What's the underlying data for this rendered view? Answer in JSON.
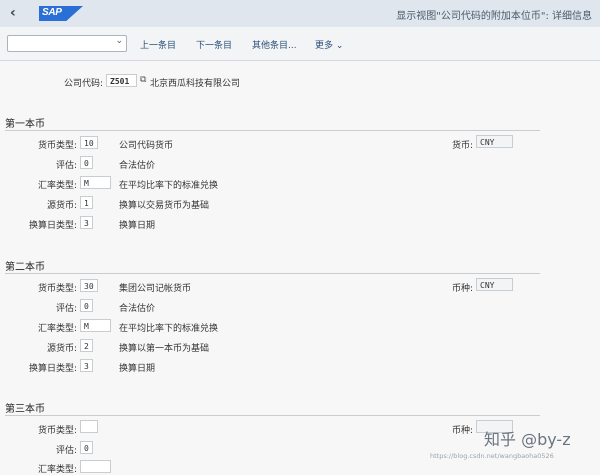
{
  "title": {
    "back": "‹",
    "logo": "SAP",
    "window_title": "显示视图\"公司代码的附加本位币\": 详细信息"
  },
  "toolbar": {
    "select_value": "",
    "prev": "上一条目",
    "next": "下一条目",
    "other": "其他条目...",
    "more": "更多"
  },
  "company": {
    "label": "公司代码:",
    "code": "Z501",
    "name": "北京西瓜科技有限公司"
  },
  "sec1": {
    "title": "第一本币",
    "type_label": "货币类型:",
    "type": "10",
    "type_text": "公司代码货币",
    "curr_label": "货币:",
    "curr": "CNY",
    "val_label": "评估:",
    "val": "0",
    "val_text": "合法估价",
    "rate_label": "汇率类型:",
    "rate": "M",
    "rate_text": "在平均比率下的标准兑换",
    "src_label": "源货币:",
    "src": "1",
    "src_text": "换算以交易货币为基础",
    "date_label": "换算日类型:",
    "date": "3",
    "date_text": "换算日期"
  },
  "sec2": {
    "title": "第二本币",
    "type_label": "货币类型:",
    "type": "30",
    "type_text": "集团公司记帐货币",
    "curr_label": "币种:",
    "curr": "CNY",
    "val_label": "评估:",
    "val": "0",
    "val_text": "合法估价",
    "rate_label": "汇率类型:",
    "rate": "M",
    "rate_text": "在平均比率下的标准兑换",
    "src_label": "源货币:",
    "src": "2",
    "src_text": "换算以第一本币为基础",
    "date_label": "换算日类型:",
    "date": "3",
    "date_text": "换算日期"
  },
  "sec3": {
    "title": "第三本币",
    "type_label": "货币类型:",
    "type": "",
    "curr_label": "币种:",
    "curr": "",
    "val_label": "评估:",
    "val": "0",
    "rate_label": "汇率类型:"
  },
  "watermark": {
    "main": "知乎 @by-z",
    "url": "https://blog.csdn.net/wangbaoha0526"
  }
}
